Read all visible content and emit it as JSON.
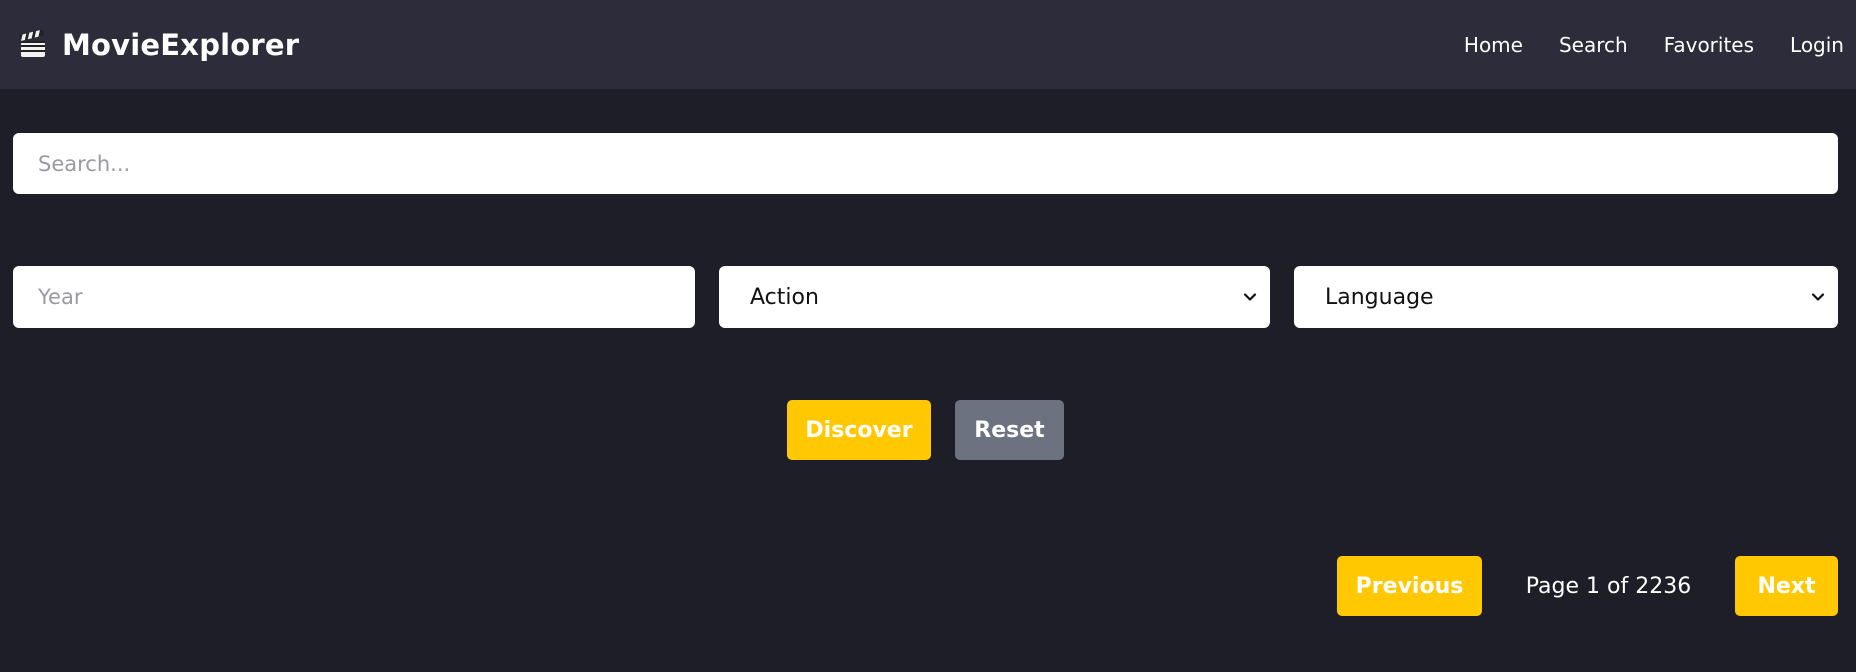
{
  "header": {
    "brand_icon": "clapperboard-icon",
    "brand_name": "MovieExplorer",
    "nav": [
      {
        "label": "Home"
      },
      {
        "label": "Search"
      },
      {
        "label": "Favorites"
      },
      {
        "label": "Login"
      }
    ]
  },
  "search": {
    "placeholder": "Search...",
    "value": ""
  },
  "filters": {
    "year_placeholder": "Year",
    "genre_selected": "Action",
    "language_selected": "Language",
    "dropdown_icon": "chevron-down-icon"
  },
  "actions": {
    "discover_label": "Discover",
    "reset_label": "Reset"
  },
  "pagination": {
    "previous_label": "Previous",
    "page_text": "Page 1 of 2236",
    "next_label": "Next"
  },
  "colors": {
    "background": "#1e1e28",
    "header_background": "#2c2c3a",
    "accent": "#ffc800",
    "secondary_button": "#6c7280"
  }
}
